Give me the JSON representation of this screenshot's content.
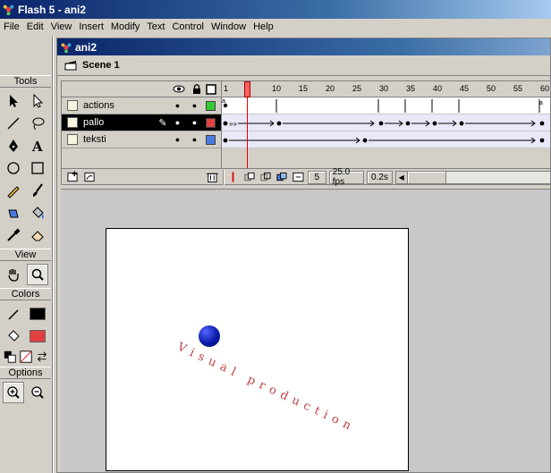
{
  "window": {
    "title": "Flash 5 - ani2"
  },
  "menu": [
    "File",
    "Edit",
    "View",
    "Insert",
    "Modify",
    "Text",
    "Control",
    "Window",
    "Help"
  ],
  "toolbox": {
    "tools_header": "Tools",
    "view_header": "View",
    "colors_header": "Colors",
    "options_header": "Options"
  },
  "document": {
    "title": "ani2",
    "scene": "Scene 1"
  },
  "timeline": {
    "ruler": [
      "1",
      "5",
      "10",
      "15",
      "20",
      "25",
      "30",
      "35",
      "40",
      "45",
      "50",
      "55",
      "60"
    ],
    "layers": [
      {
        "name": "actions",
        "color": "#33cc33"
      },
      {
        "name": "pallo",
        "color": "#e04040"
      },
      {
        "name": "teksti",
        "color": "#4a7bdf"
      }
    ],
    "current_frame": "5",
    "frame_rate": "25.0 fps",
    "elapsed": "0.2s"
  },
  "stage": {
    "text": "Visual production",
    "text_color": "#c04040",
    "ball_color": "#0a1aa8"
  }
}
